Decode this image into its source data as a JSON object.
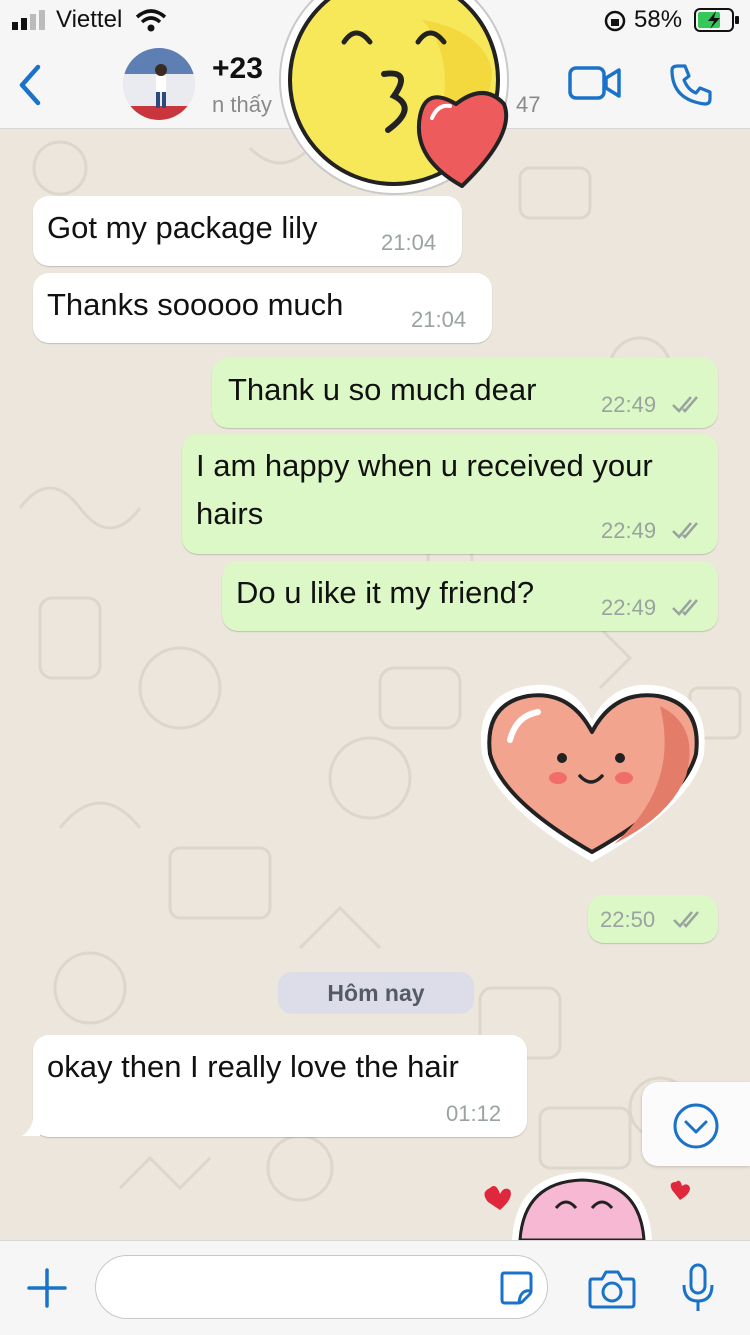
{
  "status_bar": {
    "carrier": "Viettel",
    "battery": "58%"
  },
  "header": {
    "contact_name": "+23",
    "contact_status": "n thấy",
    "contact_status_time": "47"
  },
  "messages": [
    {
      "text": "Got my package lily",
      "time": "21:04",
      "direction": "incoming"
    },
    {
      "text": "Thanks sooooo much",
      "time": "21:04",
      "direction": "incoming"
    },
    {
      "text": "Thank u so much dear",
      "time": "22:49",
      "direction": "outgoing"
    },
    {
      "text": "I am happy when u received your hairs",
      "time": "22:49",
      "direction": "outgoing"
    },
    {
      "text": "Do u like it my friend?",
      "time": "22:49",
      "direction": "outgoing"
    },
    {
      "time": "22:50",
      "direction": "outgoing",
      "sticker": "heart-sticker"
    },
    {
      "text": "okay then I really love the hair",
      "time": "01:12",
      "direction": "incoming"
    }
  ],
  "date_separator": "Hôm nay",
  "input": {
    "value": "",
    "placeholder": ""
  },
  "colors": {
    "accent": "#1a73c8",
    "outgoing_bubble": "#dcf8c6",
    "incoming_bubble": "#ffffff",
    "chat_background": "#ece6dc",
    "tick_color": "#9aa3a0"
  }
}
